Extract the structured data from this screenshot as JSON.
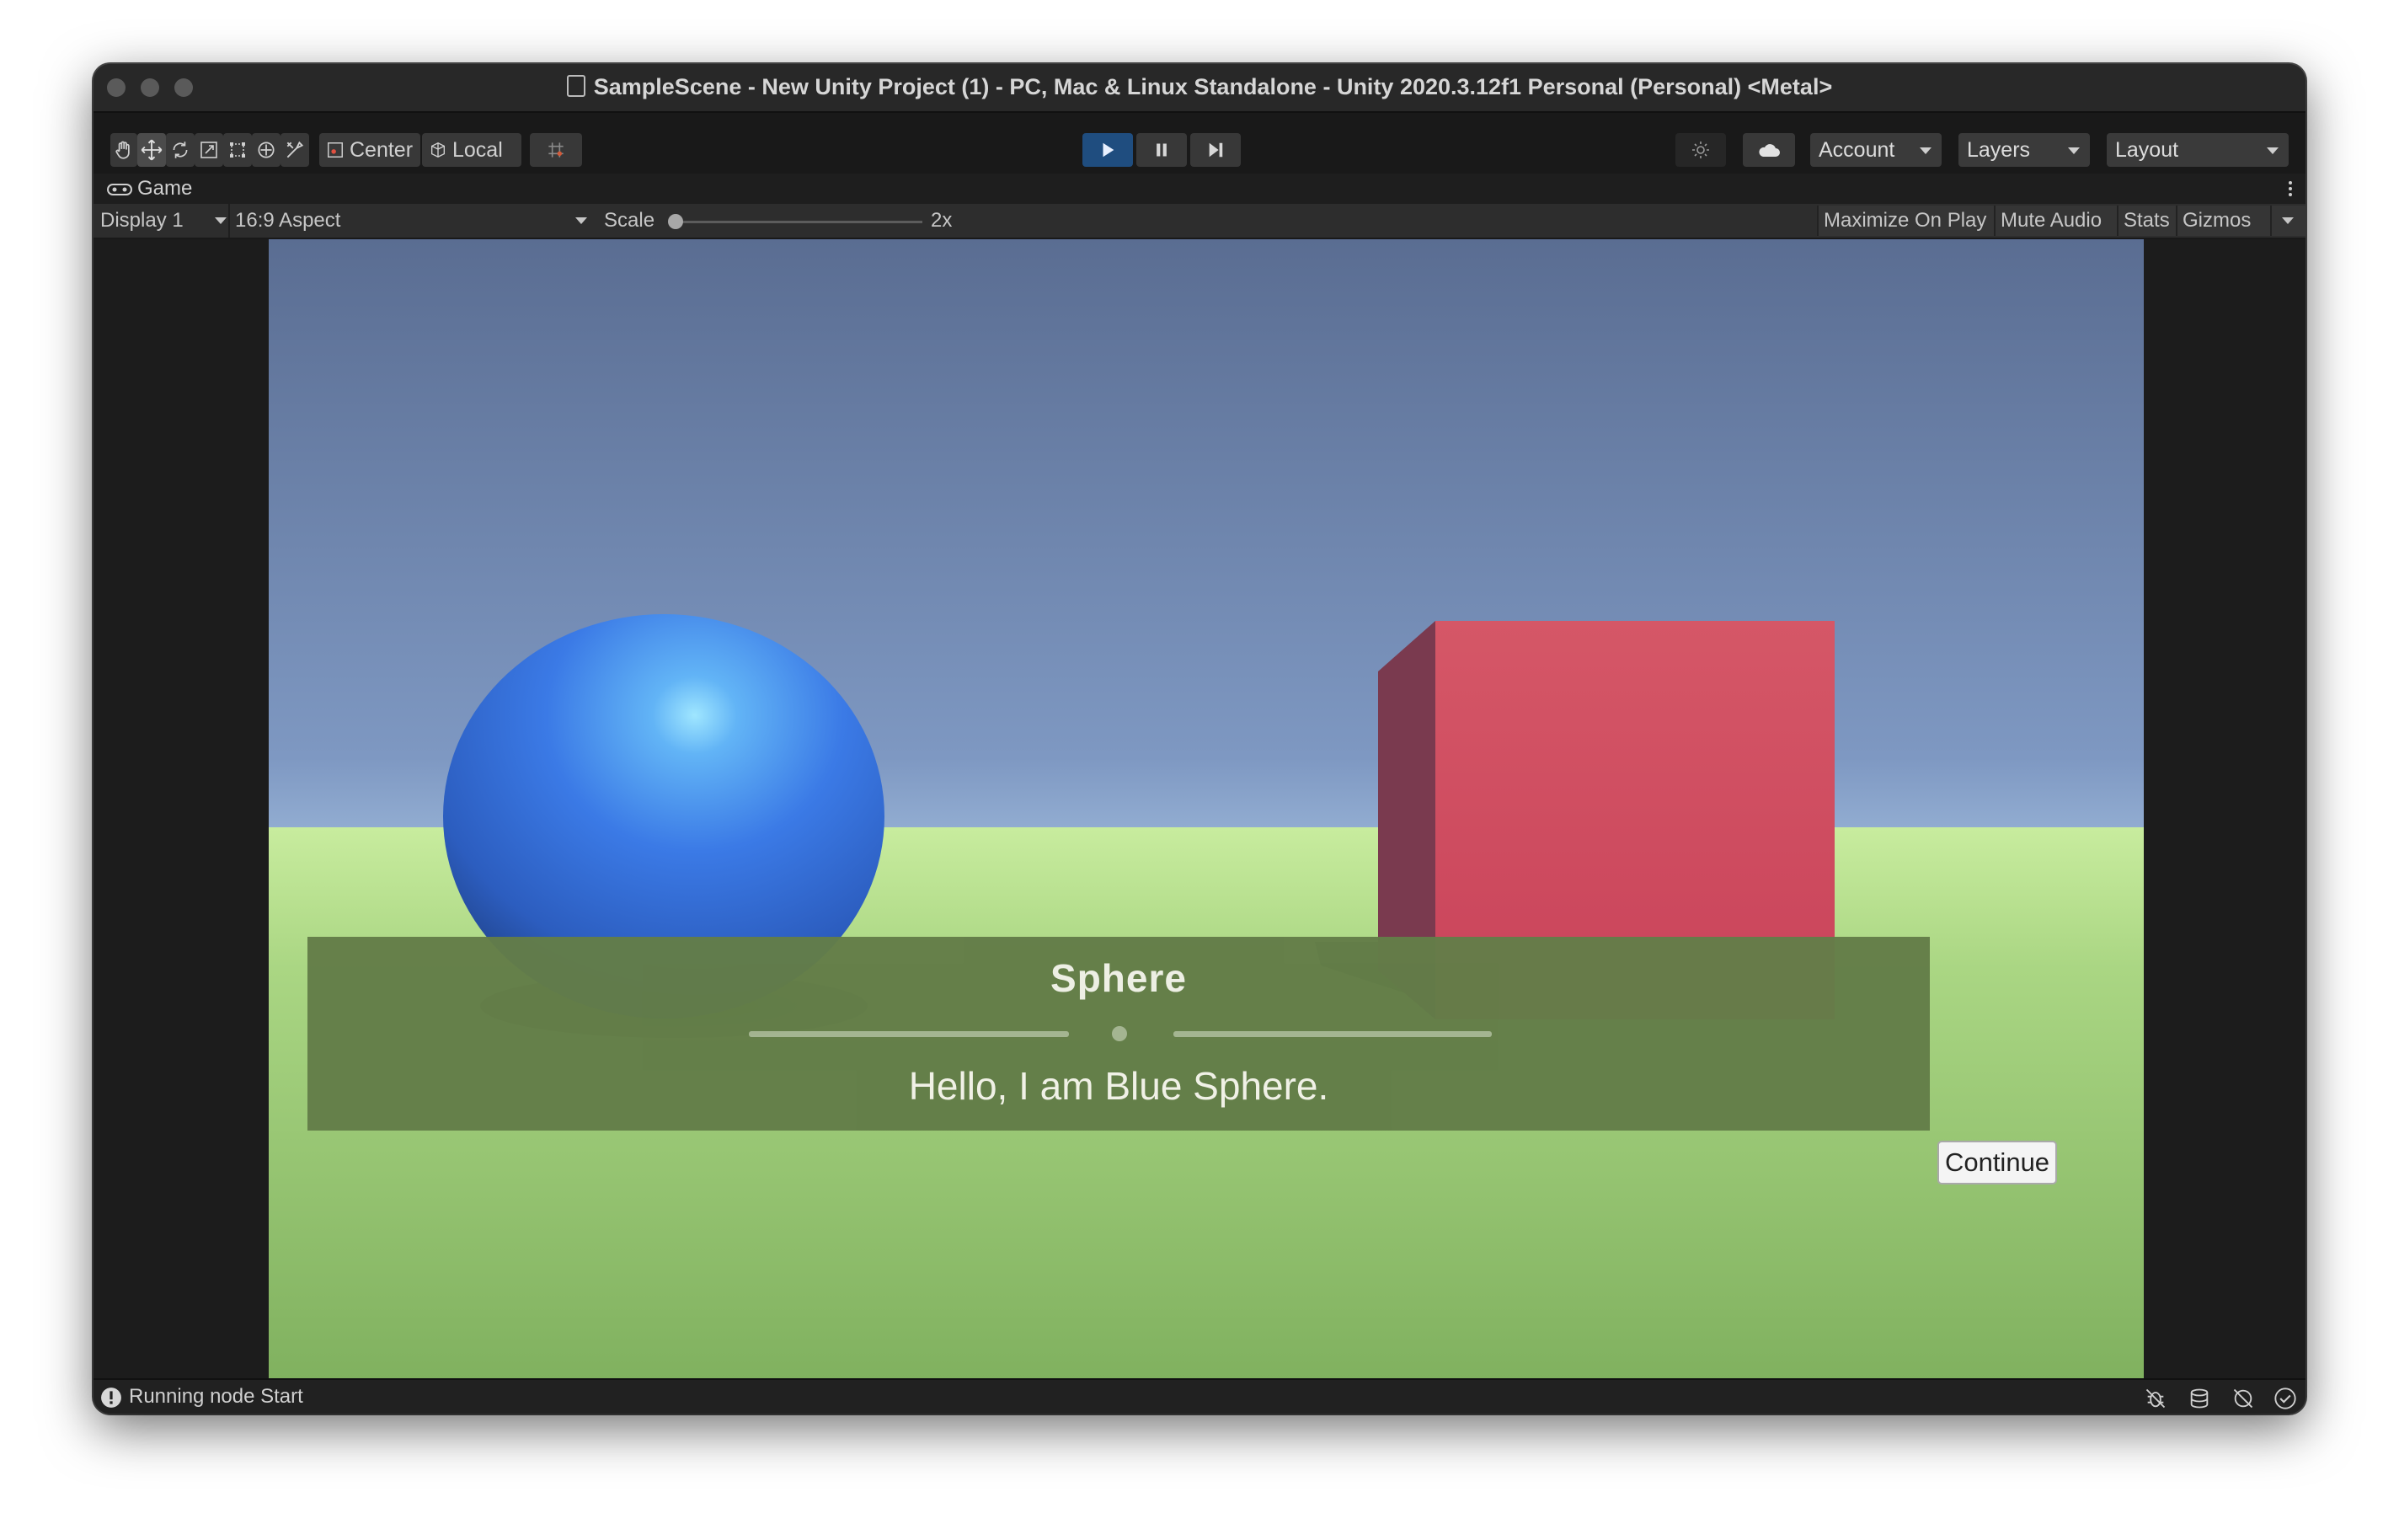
{
  "window": {
    "title": "SampleScene - New Unity Project (1) - PC, Mac & Linux Standalone - Unity 2020.3.12f1 Personal (Personal) <Metal>"
  },
  "toolbar": {
    "tools": [
      "hand-tool-icon",
      "move-tool-icon",
      "rotate-tool-icon",
      "scale-tool-icon",
      "rect-tool-icon",
      "transform-tool-icon",
      "custom-tool-icon"
    ],
    "pivot_label": "Center",
    "space_label": "Local",
    "account_label": "Account",
    "layers_label": "Layers",
    "layout_label": "Layout"
  },
  "game_view": {
    "tab_label": "Game",
    "display_label": "Display 1",
    "aspect_label": "16:9 Aspect",
    "scale_label": "Scale",
    "scale_value": "2x",
    "maximize_label": "Maximize On Play",
    "mute_label": "Mute Audio",
    "stats_label": "Stats",
    "gizmos_label": "Gizmos"
  },
  "scene": {
    "sphere_color": "#3b7ae6",
    "cube_color": "#d04a5c",
    "sky_top": "#5a6e92",
    "ground_color": "#8fbe68"
  },
  "dialogue": {
    "speaker": "Sphere",
    "line": "Hello, I am Blue Sphere.",
    "continue_label": "Continue"
  },
  "status": {
    "text": "Running node Start"
  }
}
